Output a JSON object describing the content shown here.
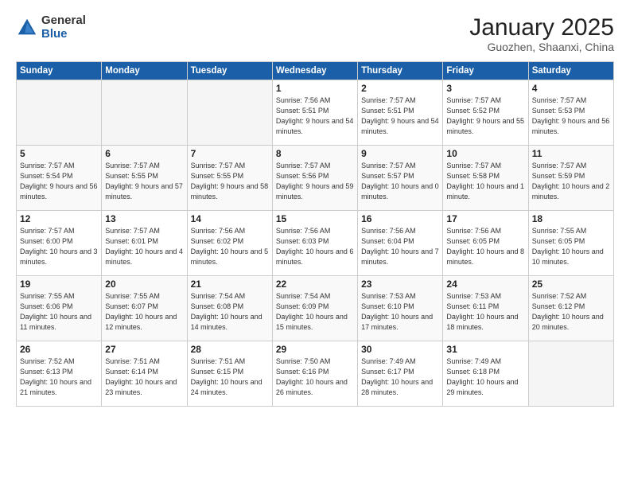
{
  "logo": {
    "general": "General",
    "blue": "Blue"
  },
  "title": "January 2025",
  "subtitle": "Guozhen, Shaanxi, China",
  "weekdays": [
    "Sunday",
    "Monday",
    "Tuesday",
    "Wednesday",
    "Thursday",
    "Friday",
    "Saturday"
  ],
  "weeks": [
    [
      {
        "day": "",
        "empty": true
      },
      {
        "day": "",
        "empty": true
      },
      {
        "day": "",
        "empty": true
      },
      {
        "day": "1",
        "sunrise": "7:56 AM",
        "sunset": "5:51 PM",
        "daylight": "9 hours and 54 minutes."
      },
      {
        "day": "2",
        "sunrise": "7:57 AM",
        "sunset": "5:51 PM",
        "daylight": "9 hours and 54 minutes."
      },
      {
        "day": "3",
        "sunrise": "7:57 AM",
        "sunset": "5:52 PM",
        "daylight": "9 hours and 55 minutes."
      },
      {
        "day": "4",
        "sunrise": "7:57 AM",
        "sunset": "5:53 PM",
        "daylight": "9 hours and 56 minutes."
      }
    ],
    [
      {
        "day": "5",
        "sunrise": "7:57 AM",
        "sunset": "5:54 PM",
        "daylight": "9 hours and 56 minutes."
      },
      {
        "day": "6",
        "sunrise": "7:57 AM",
        "sunset": "5:55 PM",
        "daylight": "9 hours and 57 minutes."
      },
      {
        "day": "7",
        "sunrise": "7:57 AM",
        "sunset": "5:55 PM",
        "daylight": "9 hours and 58 minutes."
      },
      {
        "day": "8",
        "sunrise": "7:57 AM",
        "sunset": "5:56 PM",
        "daylight": "9 hours and 59 minutes."
      },
      {
        "day": "9",
        "sunrise": "7:57 AM",
        "sunset": "5:57 PM",
        "daylight": "10 hours and 0 minutes."
      },
      {
        "day": "10",
        "sunrise": "7:57 AM",
        "sunset": "5:58 PM",
        "daylight": "10 hours and 1 minute."
      },
      {
        "day": "11",
        "sunrise": "7:57 AM",
        "sunset": "5:59 PM",
        "daylight": "10 hours and 2 minutes."
      }
    ],
    [
      {
        "day": "12",
        "sunrise": "7:57 AM",
        "sunset": "6:00 PM",
        "daylight": "10 hours and 3 minutes."
      },
      {
        "day": "13",
        "sunrise": "7:57 AM",
        "sunset": "6:01 PM",
        "daylight": "10 hours and 4 minutes."
      },
      {
        "day": "14",
        "sunrise": "7:56 AM",
        "sunset": "6:02 PM",
        "daylight": "10 hours and 5 minutes."
      },
      {
        "day": "15",
        "sunrise": "7:56 AM",
        "sunset": "6:03 PM",
        "daylight": "10 hours and 6 minutes."
      },
      {
        "day": "16",
        "sunrise": "7:56 AM",
        "sunset": "6:04 PM",
        "daylight": "10 hours and 7 minutes."
      },
      {
        "day": "17",
        "sunrise": "7:56 AM",
        "sunset": "6:05 PM",
        "daylight": "10 hours and 8 minutes."
      },
      {
        "day": "18",
        "sunrise": "7:55 AM",
        "sunset": "6:05 PM",
        "daylight": "10 hours and 10 minutes."
      }
    ],
    [
      {
        "day": "19",
        "sunrise": "7:55 AM",
        "sunset": "6:06 PM",
        "daylight": "10 hours and 11 minutes."
      },
      {
        "day": "20",
        "sunrise": "7:55 AM",
        "sunset": "6:07 PM",
        "daylight": "10 hours and 12 minutes."
      },
      {
        "day": "21",
        "sunrise": "7:54 AM",
        "sunset": "6:08 PM",
        "daylight": "10 hours and 14 minutes."
      },
      {
        "day": "22",
        "sunrise": "7:54 AM",
        "sunset": "6:09 PM",
        "daylight": "10 hours and 15 minutes."
      },
      {
        "day": "23",
        "sunrise": "7:53 AM",
        "sunset": "6:10 PM",
        "daylight": "10 hours and 17 minutes."
      },
      {
        "day": "24",
        "sunrise": "7:53 AM",
        "sunset": "6:11 PM",
        "daylight": "10 hours and 18 minutes."
      },
      {
        "day": "25",
        "sunrise": "7:52 AM",
        "sunset": "6:12 PM",
        "daylight": "10 hours and 20 minutes."
      }
    ],
    [
      {
        "day": "26",
        "sunrise": "7:52 AM",
        "sunset": "6:13 PM",
        "daylight": "10 hours and 21 minutes."
      },
      {
        "day": "27",
        "sunrise": "7:51 AM",
        "sunset": "6:14 PM",
        "daylight": "10 hours and 23 minutes."
      },
      {
        "day": "28",
        "sunrise": "7:51 AM",
        "sunset": "6:15 PM",
        "daylight": "10 hours and 24 minutes."
      },
      {
        "day": "29",
        "sunrise": "7:50 AM",
        "sunset": "6:16 PM",
        "daylight": "10 hours and 26 minutes."
      },
      {
        "day": "30",
        "sunrise": "7:49 AM",
        "sunset": "6:17 PM",
        "daylight": "10 hours and 28 minutes."
      },
      {
        "day": "31",
        "sunrise": "7:49 AM",
        "sunset": "6:18 PM",
        "daylight": "10 hours and 29 minutes."
      },
      {
        "day": "",
        "empty": true
      }
    ]
  ]
}
